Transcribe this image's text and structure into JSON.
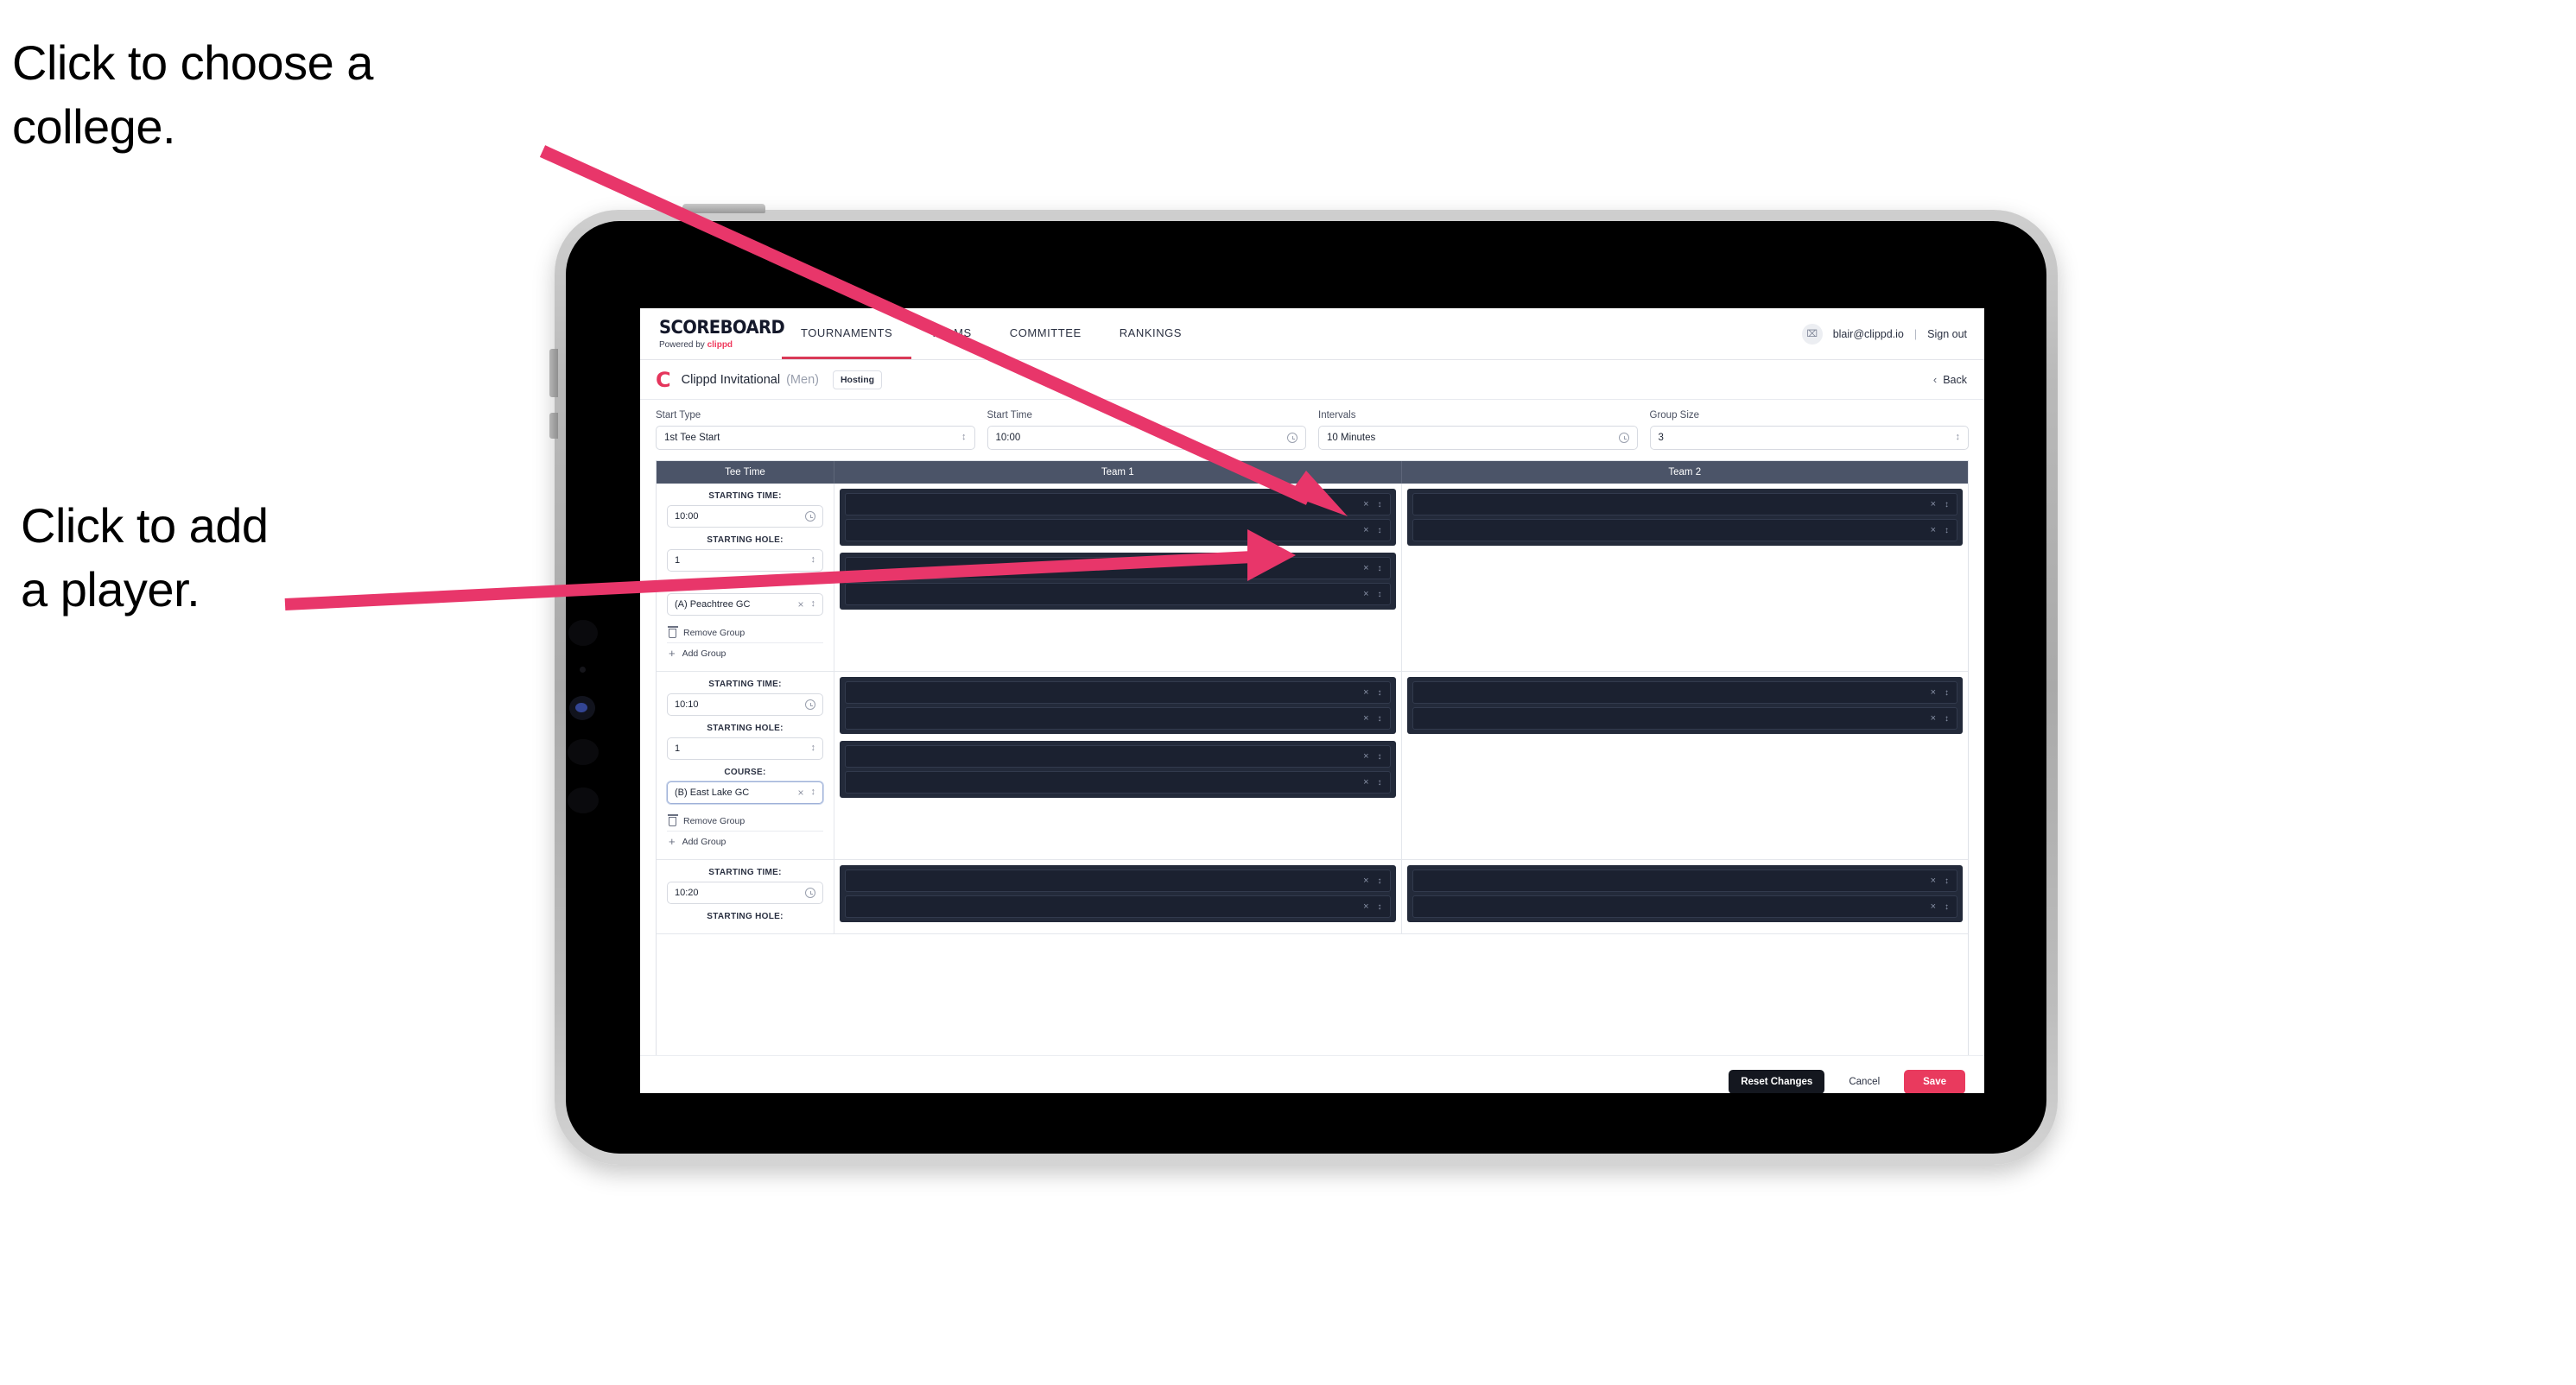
{
  "annotations": {
    "college": "Click to choose a\ncollege.",
    "player": "Click to add\na player.",
    "arrow_color": "#e8366a"
  },
  "nav": {
    "brand_word": "SCOREBOARD",
    "brand_sub_prefix": "Powered by ",
    "brand_sub_keyword": "clippd",
    "tabs": [
      {
        "label": "TOURNAMENTS",
        "active": true
      },
      {
        "label": "TEAMS",
        "active": false
      },
      {
        "label": "COMMITTEE",
        "active": false
      },
      {
        "label": "RANKINGS",
        "active": false
      }
    ],
    "avatar_glyph": "⌧",
    "email": "blair@clippd.io",
    "separator": "|",
    "sign_out": "Sign out"
  },
  "tournament_bar": {
    "logo_glyph": "C",
    "name": "Clippd Invitational",
    "gender": "(Men)",
    "hosting_badge": "Hosting",
    "back_chevron": "‹",
    "back_label": "Back"
  },
  "controls": [
    {
      "label": "Start Type",
      "value": "1st Tee Start",
      "icon": "stepper"
    },
    {
      "label": "Start Time",
      "value": "10:00",
      "icon": "clock"
    },
    {
      "label": "Intervals",
      "value": "10 Minutes",
      "icon": "clock"
    },
    {
      "label": "Group Size",
      "value": "3",
      "icon": "stepper"
    }
  ],
  "table": {
    "headers": [
      "Tee Time",
      "Team 1",
      "Team 2"
    ],
    "field_labels": {
      "starting_time": "STARTING TIME:",
      "starting_hole": "STARTING HOLE:",
      "course": "COURSE:"
    },
    "group_actions": {
      "remove": "Remove Group",
      "add": "Add Group"
    },
    "rows": [
      {
        "starting_time": "10:00",
        "starting_hole": "1",
        "course": "(A) Peachtree GC",
        "course_focused": false,
        "team1_groups": [
          2,
          2
        ],
        "team2_groups": [
          2
        ]
      },
      {
        "starting_time": "10:10",
        "starting_hole": "1",
        "course": "(B) East Lake GC",
        "course_focused": true,
        "team1_groups": [
          2,
          2
        ],
        "team2_groups": [
          2
        ]
      },
      {
        "starting_time": "10:20",
        "starting_hole": "",
        "course": "",
        "course_focused": false,
        "team1_groups": [
          2
        ],
        "team2_groups": [
          2
        ]
      }
    ]
  },
  "footer": {
    "reset": "Reset Changes",
    "cancel": "Cancel",
    "save": "Save",
    "save_color": "#e93a5e"
  }
}
